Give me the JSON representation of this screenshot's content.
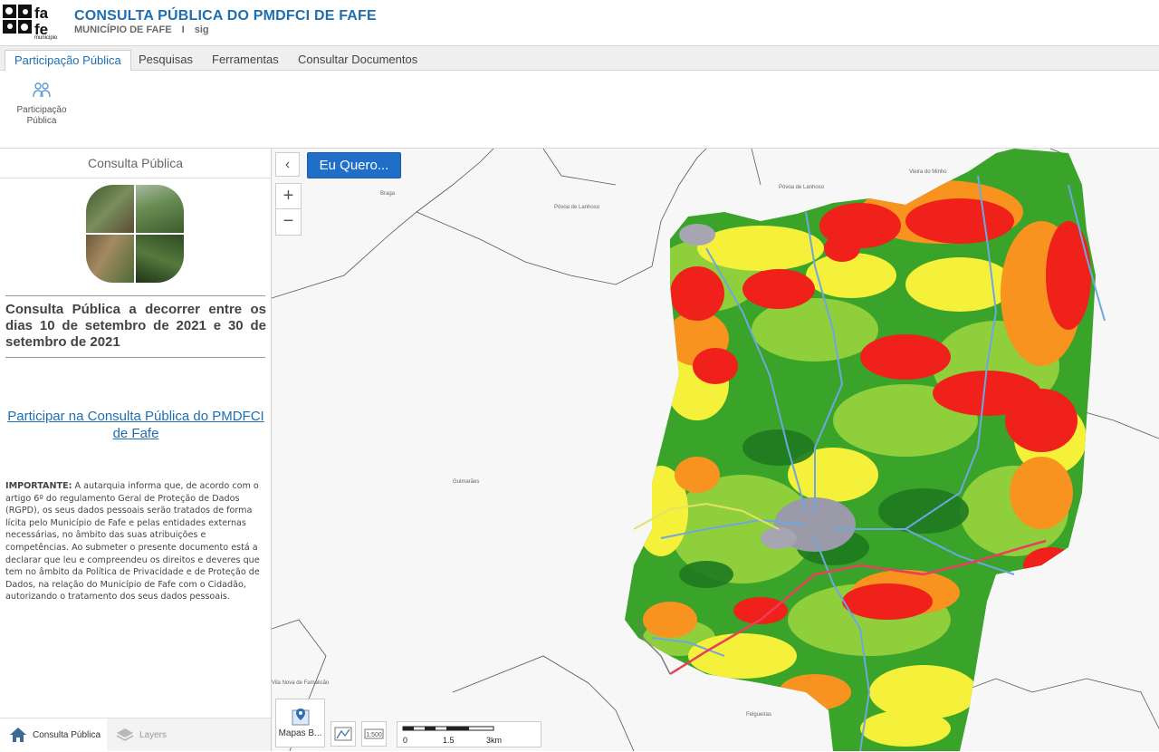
{
  "header": {
    "title": "CONSULTA PÚBLICA DO PMDFCI DE FAFE",
    "subtitle_org": "MUNICÍPIO DE FAFE",
    "subtitle_sep": "I",
    "subtitle_app": "sig",
    "logo_text": "municipio"
  },
  "tabs": [
    {
      "label": "Participação Pública",
      "active": true
    },
    {
      "label": "Pesquisas",
      "active": false
    },
    {
      "label": "Ferramentas",
      "active": false
    },
    {
      "label": "Consultar Documentos",
      "active": false
    }
  ],
  "ribbon": {
    "button_label_1": "Participação",
    "button_label_2": "Pública",
    "icon": "people-icon"
  },
  "panel": {
    "title": "Consulta Pública",
    "headline": "Consulta Pública a decorrer entre os dias 10 de setembro de 2021 e 30 de setembro de 2021",
    "link": "Participar na Consulta Pública do PMDFCI de Fafe",
    "important_label": "IMPORTANTE:",
    "important_text": " A autarquia informa que, de acordo com o artigo 6º do regulamento Geral de Proteção de Dados (RGPD), os seus dados pessoais serão tratados de forma lícita pelo Município de Fafe e pelas entidades externas necessárias, no âmbito das suas atribuições e competências. Ao submeter o presente documento está a declarar que leu e compreendeu os direitos e deveres que tem no âmbito da Política de Privacidade e de Proteção de Dados, na relação do Município de Fafe com o Cidadão, autorizando o tratamento dos seus dados pessoais.",
    "footer_tabs": [
      {
        "label": "Consulta Pública",
        "icon": "home-icon",
        "active": true
      },
      {
        "label": "Layers",
        "icon": "layers-icon",
        "active": false
      }
    ]
  },
  "map": {
    "eu_quero": "Eu Quero...",
    "collapse": "‹",
    "zoom_in": "+",
    "zoom_out": "−",
    "places": {
      "braga": "Braga",
      "povoa1": "Póvoa de Lanhoso",
      "povoa2": "Póvoa de Lanhoso",
      "vieira": "Vieira do Minho",
      "guimaraes": "Guimarães",
      "famalicao": "Vila Nova de Famalicão",
      "felgueiras": "Felgueiras"
    },
    "basemap_label": "Mapas B...",
    "scale": {
      "t0": "0",
      "t1": "1.5",
      "t2": "3km"
    },
    "colors": {
      "red": "#f0201a",
      "orange": "#f7931e",
      "yellow": "#f5f03a",
      "lightgreen": "#8fcf3c",
      "green": "#3aa32a",
      "darkgreen": "#1f7a1f"
    }
  }
}
